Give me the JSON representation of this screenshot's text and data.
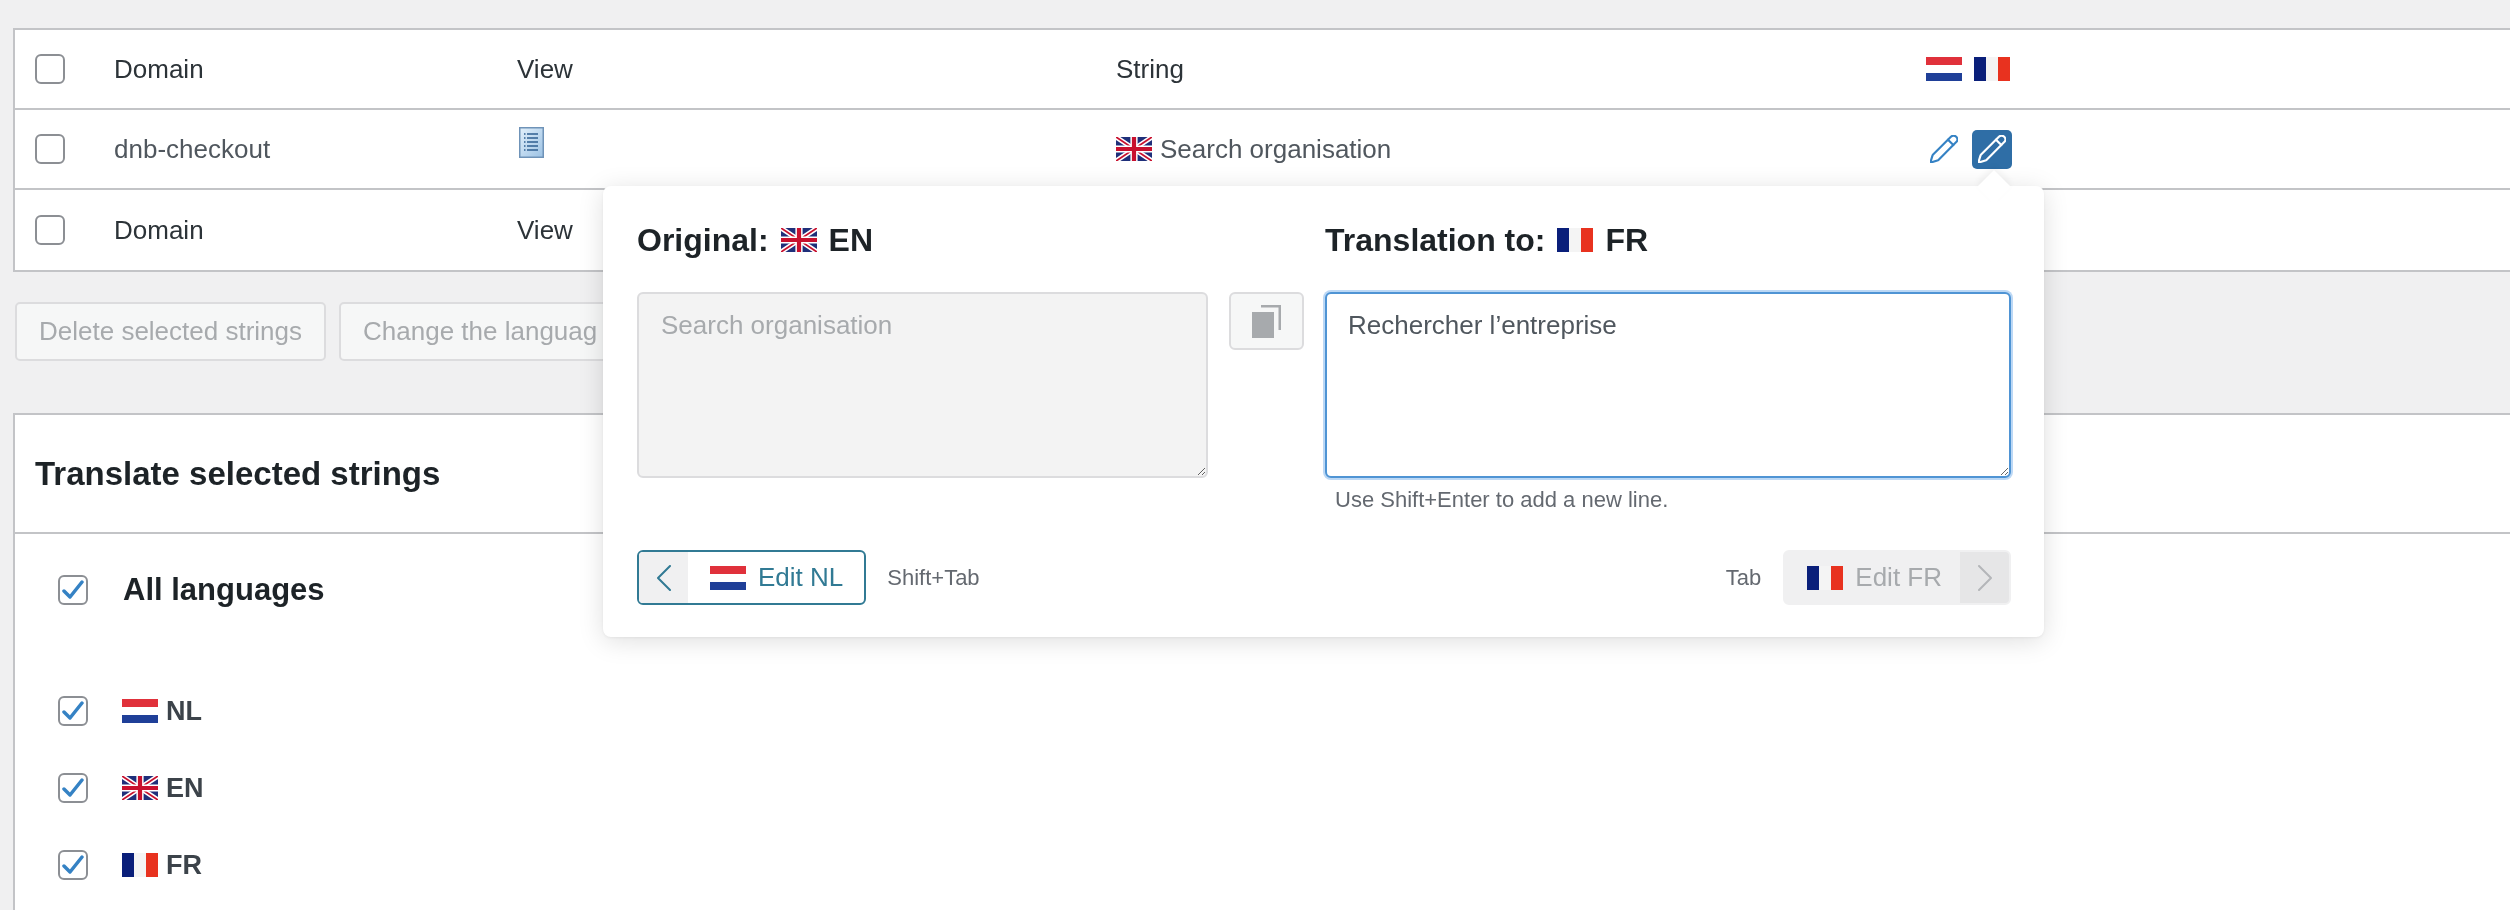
{
  "table": {
    "header": {
      "checked": false,
      "columns": [
        "Domain",
        "View",
        "String"
      ],
      "flags": [
        {
          "kind": "nl"
        },
        {
          "kind": "fr"
        }
      ]
    },
    "rows": [
      {
        "checked": false,
        "domain": "dnb-checkout",
        "string": {
          "kind": "gb",
          "text": "Search organisation"
        },
        "actions": [
          {
            "selected": false
          },
          {
            "selected": true
          }
        ]
      }
    ],
    "footer": {
      "checked": false,
      "columns": [
        "Domain",
        "View"
      ]
    }
  },
  "bulk_actions": [
    {
      "label": "Delete selected strings",
      "disabled": true
    },
    {
      "label": "Change the languag",
      "disabled": true
    }
  ],
  "popup": {
    "original": {
      "label": "Original:",
      "kind": "gb",
      "code": "EN",
      "value": "Search organisation",
      "disabled": true
    },
    "translation": {
      "label": "Translation to:",
      "kind": "fr",
      "code": "FR",
      "value": "Rechercher l’entreprise",
      "focused": true,
      "hint": "Use Shift+Enter to add a new line."
    },
    "prev": {
      "kind": "nl",
      "label": "Edit NL",
      "shortcut": "Shift+Tab",
      "disabled": false
    },
    "next": {
      "kind": "fr",
      "label": "Edit FR",
      "shortcut": "Tab",
      "disabled": true
    }
  },
  "translate_panel": {
    "title": "Translate selected strings",
    "all": {
      "label": "All languages",
      "checked": true
    },
    "languages": [
      {
        "kind": "nl",
        "code": "NL",
        "checked": true
      },
      {
        "kind": "gb",
        "code": "EN",
        "checked": true
      },
      {
        "kind": "fr",
        "code": "FR",
        "checked": true
      }
    ]
  }
}
